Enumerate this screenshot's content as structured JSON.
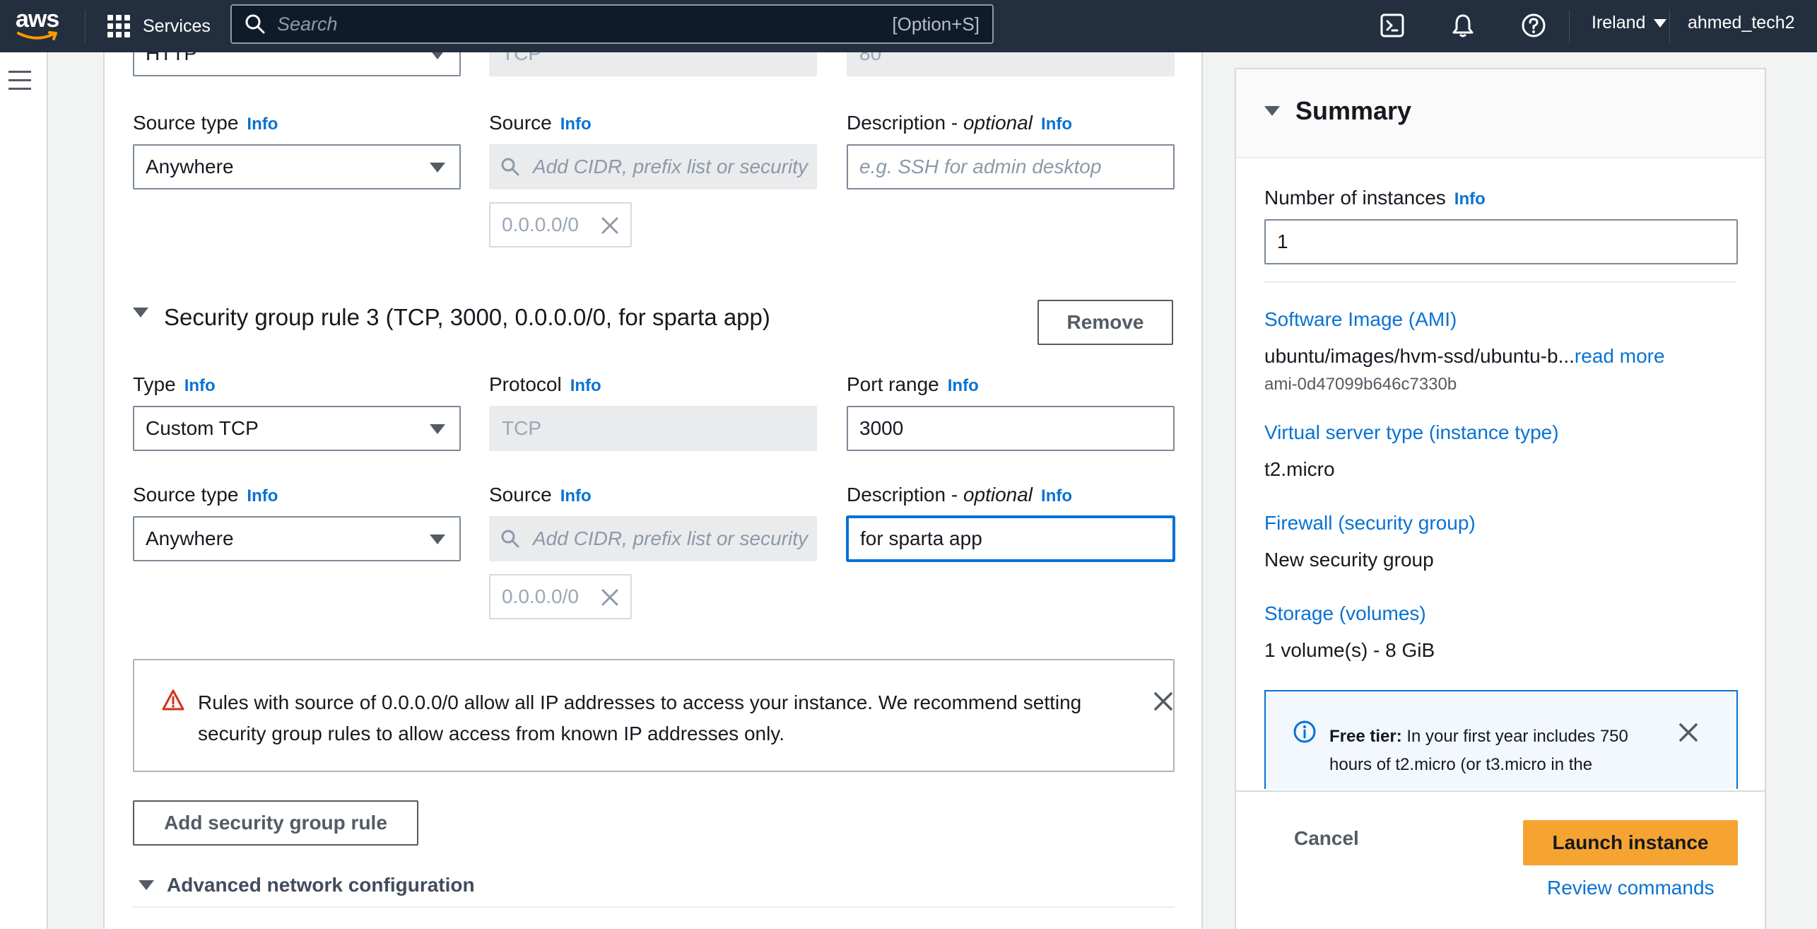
{
  "nav": {
    "logo_text": "aws",
    "services_label": "Services",
    "search_placeholder": "Search",
    "search_shortcut": "[Option+S]",
    "region": "Ireland",
    "user": "ahmed_tech2"
  },
  "rule2_partial": {
    "type_value": "HTTP",
    "protocol_value": "TCP",
    "port_value": "80",
    "source_type_label": "Source type",
    "source_type_value": "Anywhere",
    "source_label": "Source",
    "source_placeholder": "Add CIDR, prefix list or security",
    "source_token": "0.0.0.0/0",
    "description_label": "Description - ",
    "description_optional": "optional",
    "description_placeholder": "e.g. SSH for admin desktop"
  },
  "rule3": {
    "title": "Security group rule 3 (TCP, 3000, 0.0.0.0/0, for sparta app)",
    "remove_label": "Remove",
    "type_label": "Type",
    "type_value": "Custom TCP",
    "protocol_label": "Protocol",
    "protocol_value": "TCP",
    "port_label": "Port range",
    "port_value": "3000",
    "source_type_label": "Source type",
    "source_type_value": "Anywhere",
    "source_label": "Source",
    "source_placeholder": "Add CIDR, prefix list or security",
    "source_token": "0.0.0.0/0",
    "description_label": "Description - ",
    "description_optional": "optional",
    "description_value": "for sparta app"
  },
  "info_label": "Info",
  "warning": {
    "text": "Rules with source of 0.0.0.0/0 allow all IP addresses to access your instance. We recommend setting security group rules to allow access from known IP addresses only."
  },
  "add_rule_label": "Add security group rule",
  "advanced_label": "Advanced network configuration",
  "summary": {
    "title": "Summary",
    "instances_label": "Number of instances",
    "instances_value": "1",
    "ami_label": "Software Image (AMI)",
    "ami_value": "ubuntu/images/hvm-ssd/ubuntu-b...",
    "ami_read_more": "read more",
    "ami_id": "ami-0d47099b646c7330b",
    "instance_type_label": "Virtual server type (instance type)",
    "instance_type_value": "t2.micro",
    "firewall_label": "Firewall (security group)",
    "firewall_value": "New security group",
    "storage_label": "Storage (volumes)",
    "storage_value": "1 volume(s) - 8 GiB",
    "free_tier_bold": "Free tier:",
    "free_tier_text": " In your first year includes 750 hours of t2.micro (or t3.micro in the",
    "cancel_label": "Cancel",
    "launch_label": "Launch instance",
    "review_label": "Review commands"
  },
  "colors": {
    "nav_bg": "#232f3e",
    "link": "#0972d3",
    "primary_button": "#f5a432",
    "warning_icon": "#d13212"
  }
}
